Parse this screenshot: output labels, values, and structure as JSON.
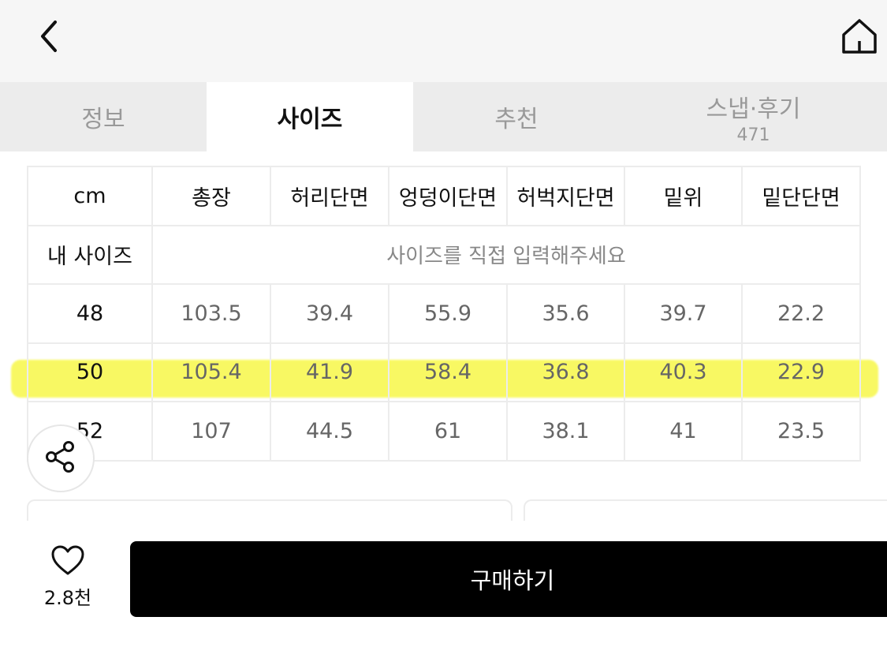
{
  "tabs": [
    {
      "label": "정보",
      "count": ""
    },
    {
      "label": "사이즈",
      "count": ""
    },
    {
      "label": "추천",
      "count": ""
    },
    {
      "label": "스냅·후기",
      "count": "471"
    }
  ],
  "active_tab": "사이즈",
  "size_table": {
    "unit_label": "cm",
    "columns": [
      "총장",
      "허리단면",
      "엉덩이단면",
      "허벅지단면",
      "밑위",
      "밑단단면"
    ],
    "my_size": {
      "label": "내 사이즈",
      "placeholder": "사이즈를 직접 입력해주세요"
    },
    "rows": [
      {
        "size": "48",
        "values": [
          "103.5",
          "39.4",
          "55.9",
          "35.6",
          "39.7",
          "22.2"
        ]
      },
      {
        "size": "50",
        "values": [
          "105.4",
          "41.9",
          "58.4",
          "36.8",
          "40.3",
          "22.9"
        ]
      },
      {
        "size": "52",
        "values": [
          "107",
          "44.5",
          "61",
          "38.1",
          "41",
          "23.5"
        ]
      }
    ],
    "highlighted_row": "50",
    "highlight_color": "#f6f628"
  },
  "bottom": {
    "like_count": "2.8천",
    "buy_label": "구매하기"
  },
  "icons": [
    "back-icon",
    "home-icon",
    "share-icon",
    "heart-icon"
  ]
}
